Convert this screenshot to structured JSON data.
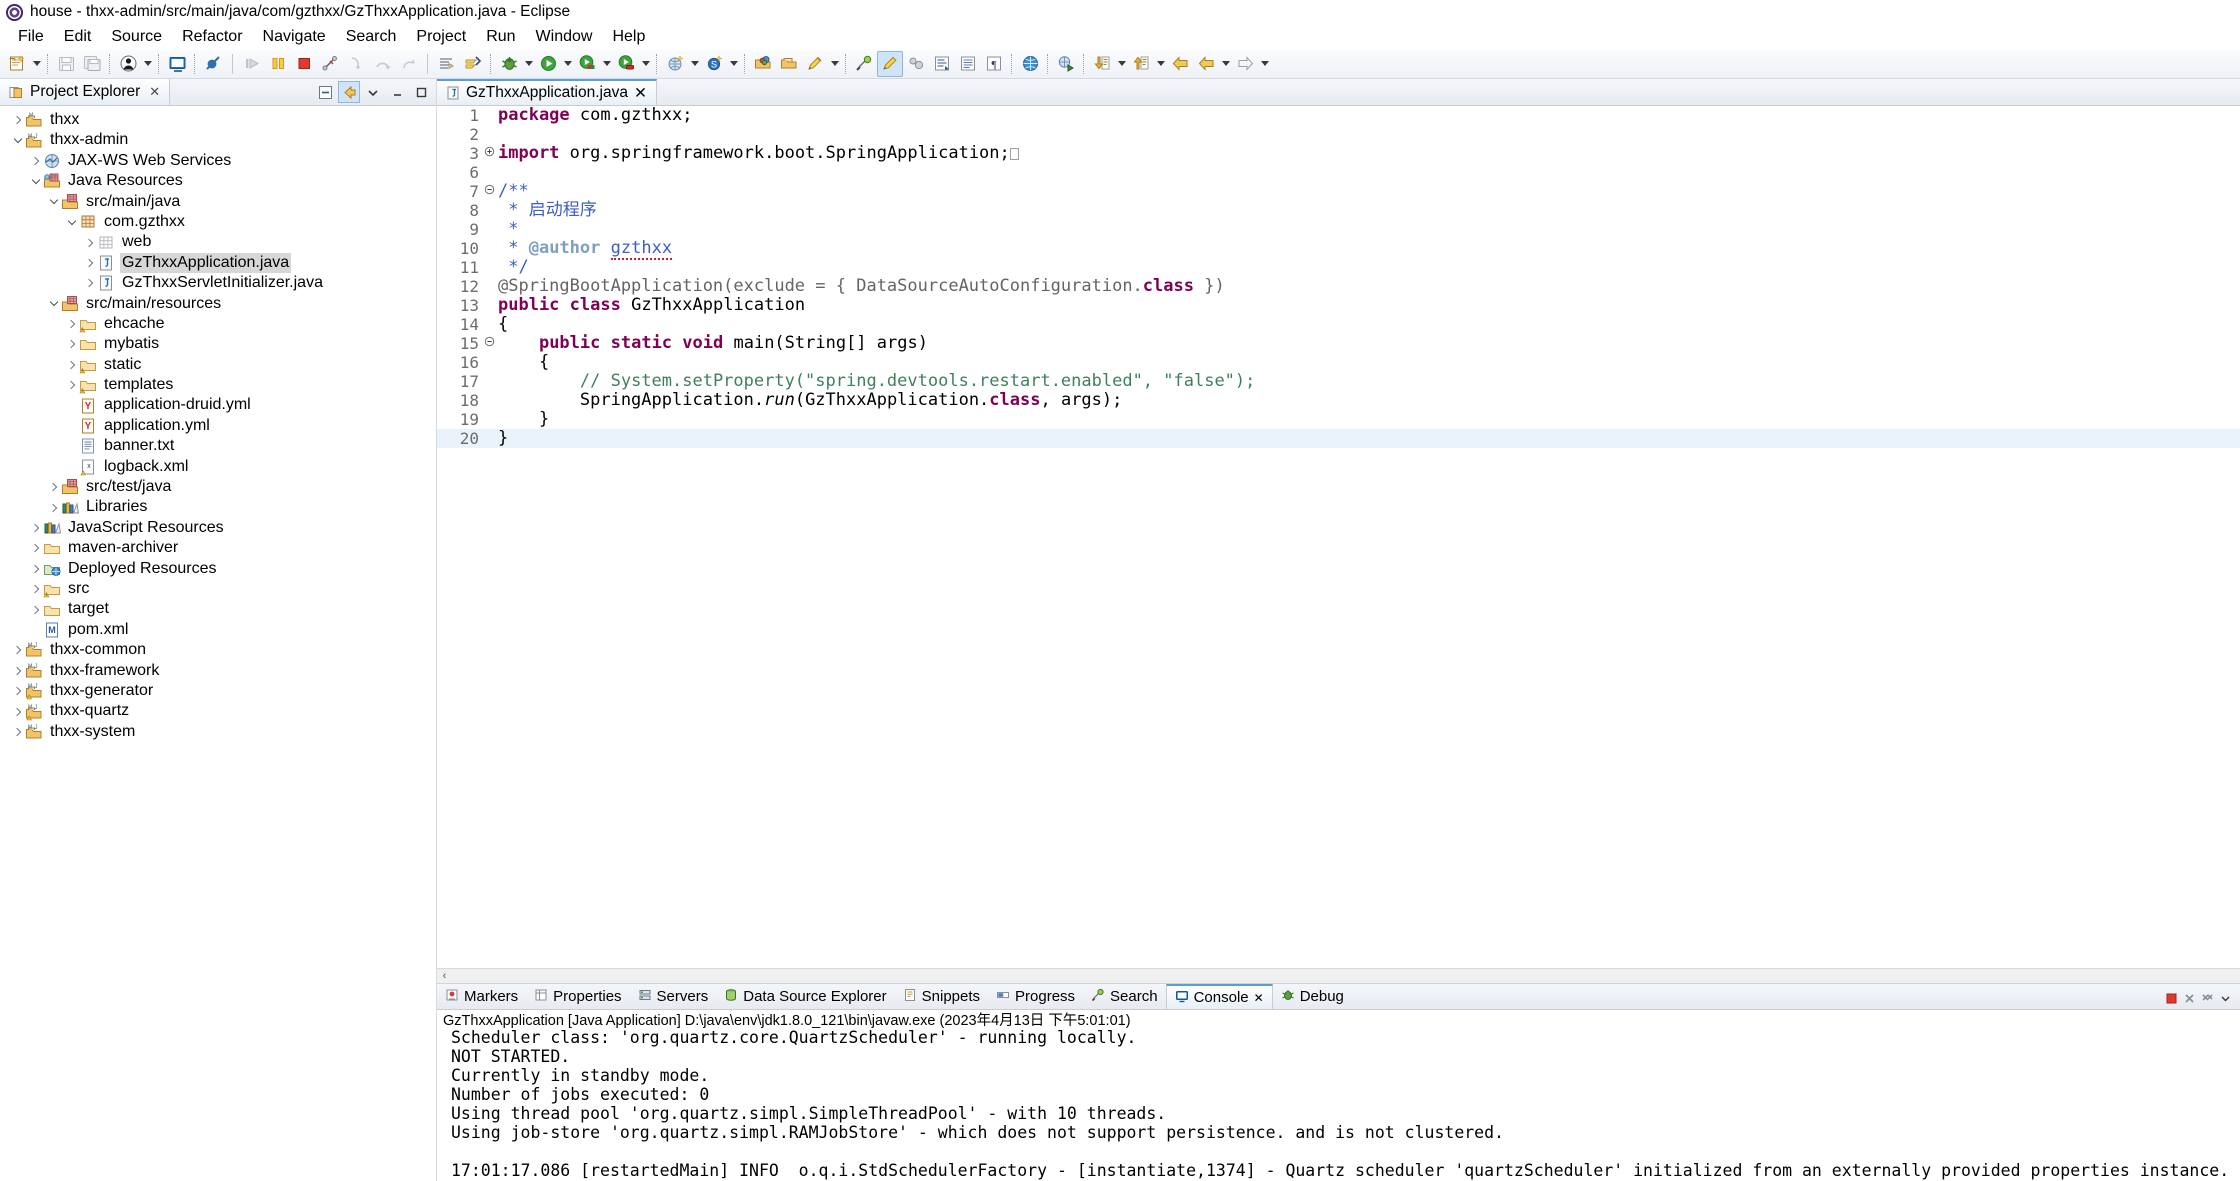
{
  "window": {
    "title": "house - thxx-admin/src/main/java/com/gzthxx/GzThxxApplication.java - Eclipse",
    "app_icon": "eclipse-icon"
  },
  "menubar": {
    "items": [
      {
        "label": "File"
      },
      {
        "label": "Edit"
      },
      {
        "label": "Source"
      },
      {
        "label": "Refactor"
      },
      {
        "label": "Navigate"
      },
      {
        "label": "Search"
      },
      {
        "label": "Project"
      },
      {
        "label": "Run"
      },
      {
        "label": "Window"
      },
      {
        "label": "Help"
      }
    ]
  },
  "toolbar": {
    "groups": [
      [
        "new-wizard-icon",
        "dropdown",
        "save-icon",
        "save-all-icon"
      ],
      [
        "debug-person-icon",
        "dropdown"
      ],
      [
        "console-icon"
      ],
      [
        "toggle-breakpoint-off-icon"
      ],
      [
        "resume-icon",
        "suspend-icon",
        "terminate-icon",
        "disconnect-icon",
        "step-into-icon",
        "step-over-icon",
        "step-return-icon"
      ],
      [
        "skip-breakpoints-icon",
        "run-last-tool-icon"
      ],
      [
        "debug-bug-icon",
        "dropdown",
        "run-icon",
        "dropdown",
        "run-coverage-icon",
        "dropdown",
        "external-tools-icon",
        "dropdown"
      ],
      [
        "new-java-project-icon",
        "dropdown",
        "new-class-icon",
        "dropdown"
      ],
      [
        "open-type-icon",
        "open-task-icon",
        "annotate-icon",
        "dropdown"
      ],
      [
        "search-icon",
        "link-editor-icon"
      ],
      [
        "toggle-mark-occurrences-icon",
        "toggle-block-selection-icon",
        "show-whitespace-icon",
        "show-pilcrow-icon"
      ],
      [
        "open-web-browser-icon"
      ],
      [
        "profile-icon"
      ],
      [
        "next-annotation-icon",
        "dropdown",
        "previous-annotation-icon",
        "dropdown",
        "back-icon",
        "forward-icon",
        "dropdown",
        "forward-next-icon",
        "dropdown"
      ]
    ]
  },
  "explorer": {
    "tab_label": "Project Explorer",
    "tab_icon": "project-explorer-icon",
    "close_glyph": "✕",
    "tools": [
      "collapse-all-icon",
      "link-with-editor-icon",
      "view-menu-icon",
      "minimize-icon",
      "maximize-icon"
    ],
    "tree": [
      {
        "label": "thxx",
        "depth": 0,
        "twist": "right",
        "icon": "maven-project-icon"
      },
      {
        "label": "thxx-admin",
        "depth": 0,
        "twist": "down",
        "icon": "maven-java-project-icon"
      },
      {
        "label": "JAX-WS Web Services",
        "depth": 1,
        "twist": "right",
        "icon": "jaxws-icon"
      },
      {
        "label": "Java Resources",
        "depth": 1,
        "twist": "down",
        "icon": "java-resources-icon"
      },
      {
        "label": "src/main/java",
        "depth": 2,
        "twist": "down",
        "icon": "source-folder-icon"
      },
      {
        "label": "com.gzthxx",
        "depth": 3,
        "twist": "down",
        "icon": "package-icon"
      },
      {
        "label": "web",
        "depth": 4,
        "twist": "right",
        "icon": "package-empty-icon"
      },
      {
        "label": "GzThxxApplication.java",
        "depth": 4,
        "twist": "right",
        "icon": "java-file-icon",
        "selected": true
      },
      {
        "label": "GzThxxServletInitializer.java",
        "depth": 4,
        "twist": "right",
        "icon": "java-file-icon"
      },
      {
        "label": "src/main/resources",
        "depth": 2,
        "twist": "down",
        "icon": "source-folder-icon"
      },
      {
        "label": "ehcache",
        "depth": 3,
        "twist": "right",
        "icon": "folder-warn-icon"
      },
      {
        "label": "mybatis",
        "depth": 3,
        "twist": "right",
        "icon": "folder-icon"
      },
      {
        "label": "static",
        "depth": 3,
        "twist": "right",
        "icon": "folder-warn-icon"
      },
      {
        "label": "templates",
        "depth": 3,
        "twist": "right",
        "icon": "folder-warn-icon"
      },
      {
        "label": "application-druid.yml",
        "depth": 3,
        "twist": "none",
        "icon": "yml-file-icon"
      },
      {
        "label": "application.yml",
        "depth": 3,
        "twist": "none",
        "icon": "yml-file-icon"
      },
      {
        "label": "banner.txt",
        "depth": 3,
        "twist": "none",
        "icon": "txt-file-icon"
      },
      {
        "label": "logback.xml",
        "depth": 3,
        "twist": "none",
        "icon": "xml-file-icon"
      },
      {
        "label": "src/test/java",
        "depth": 2,
        "twist": "right",
        "icon": "source-folder-icon"
      },
      {
        "label": "Libraries",
        "depth": 2,
        "twist": "right",
        "icon": "libraries-icon"
      },
      {
        "label": "JavaScript Resources",
        "depth": 1,
        "twist": "right",
        "icon": "libraries-icon"
      },
      {
        "label": "maven-archiver",
        "depth": 1,
        "twist": "right",
        "icon": "folder-icon"
      },
      {
        "label": "Deployed Resources",
        "depth": 1,
        "twist": "right",
        "icon": "deployed-resources-icon"
      },
      {
        "label": "src",
        "depth": 1,
        "twist": "right",
        "icon": "folder-warn-icon"
      },
      {
        "label": "target",
        "depth": 1,
        "twist": "right",
        "icon": "folder-icon"
      },
      {
        "label": "pom.xml",
        "depth": 1,
        "twist": "none",
        "icon": "maven-pom-icon"
      },
      {
        "label": "thxx-common",
        "depth": 0,
        "twist": "right",
        "icon": "maven-java-project-icon"
      },
      {
        "label": "thxx-framework",
        "depth": 0,
        "twist": "right",
        "icon": "maven-java-project-icon"
      },
      {
        "label": "thxx-generator",
        "depth": 0,
        "twist": "right",
        "icon": "maven-java-project-warn-icon"
      },
      {
        "label": "thxx-quartz",
        "depth": 0,
        "twist": "right",
        "icon": "maven-java-project-warn-icon"
      },
      {
        "label": "thxx-system",
        "depth": 0,
        "twist": "right",
        "icon": "maven-java-project-icon"
      }
    ]
  },
  "editor": {
    "tab_label": "GzThxxApplication.java",
    "tab_icon": "java-file-icon",
    "close_glyph": "✕",
    "lines": [
      {
        "no": "1",
        "fold": "",
        "text": "package com.gzthxx;"
      },
      {
        "no": "2",
        "fold": "",
        "text": ""
      },
      {
        "no": "3",
        "fold": "+",
        "text": "import org.springframework.boot.SpringApplication;"
      },
      {
        "no": "6",
        "fold": "",
        "text": ""
      },
      {
        "no": "7",
        "fold": "-",
        "text": "/**"
      },
      {
        "no": "8",
        "fold": "",
        "text": " * 启动程序"
      },
      {
        "no": "9",
        "fold": "",
        "text": " *"
      },
      {
        "no": "10",
        "fold": "",
        "text": " * @author gzthxx"
      },
      {
        "no": "11",
        "fold": "",
        "text": " */"
      },
      {
        "no": "12",
        "fold": "",
        "text": "@SpringBootApplication(exclude = { DataSourceAutoConfiguration.class })"
      },
      {
        "no": "13",
        "fold": "",
        "text": "public class GzThxxApplication"
      },
      {
        "no": "14",
        "fold": "",
        "text": "{"
      },
      {
        "no": "15",
        "fold": "-",
        "text": "    public static void main(String[] args)"
      },
      {
        "no": "16",
        "fold": "",
        "text": "    {"
      },
      {
        "no": "17",
        "fold": "",
        "text": "        // System.setProperty(\"spring.devtools.restart.enabled\", \"false\");"
      },
      {
        "no": "18",
        "fold": "",
        "text": "        SpringApplication.run(GzThxxApplication.class, args);"
      },
      {
        "no": "19",
        "fold": "",
        "text": "    }"
      },
      {
        "no": "20",
        "fold": "",
        "text": "}"
      }
    ]
  },
  "console": {
    "tabs": [
      {
        "label": "Markers",
        "icon": "markers-icon",
        "active": false
      },
      {
        "label": "Properties",
        "icon": "properties-icon",
        "active": false
      },
      {
        "label": "Servers",
        "icon": "servers-icon",
        "active": false
      },
      {
        "label": "Data Source Explorer",
        "icon": "datasource-icon",
        "active": false
      },
      {
        "label": "Snippets",
        "icon": "snippets-icon",
        "active": false
      },
      {
        "label": "Progress",
        "icon": "progress-icon",
        "active": false
      },
      {
        "label": "Search",
        "icon": "search-icon",
        "active": false
      },
      {
        "label": "Console",
        "icon": "console-icon",
        "active": true
      },
      {
        "label": "Debug",
        "icon": "debug-icon",
        "active": false
      }
    ],
    "close_glyph": "✕",
    "tools": [
      "terminate-icon",
      "remove-launch-icon",
      "remove-all-icon",
      "view-menu-icon"
    ],
    "process_line": "GzThxxApplication [Java Application] D:\\java\\env\\jdk1.8.0_121\\bin\\javaw.exe (2023年4月13日 下午5:01:01)",
    "output": [
      "Scheduler class: 'org.quartz.core.QuartzScheduler' - running locally.",
      "NOT STARTED.",
      "Currently in standby mode.",
      "Number of jobs executed: 0",
      "Using thread pool 'org.quartz.simpl.SimpleThreadPool' - with 10 threads.",
      "Using job-store 'org.quartz.simpl.RAMJobStore' - which does not support persistence. and is not clustered.",
      "",
      "17:01:17.086 [restartedMain] INFO  o.q.i.StdSchedulerFactory - [instantiate,1374] - Quartz scheduler 'quartzScheduler' initialized from an externally provided properties instance."
    ]
  },
  "colors": {
    "accent": "#5a9fd4",
    "keyword": "#7f0055",
    "string": "#2a00ff",
    "comment": "#3f7f5f",
    "javadoc": "#3f5fbf",
    "annotation": "#646464",
    "selection": "#d7d7d7"
  }
}
